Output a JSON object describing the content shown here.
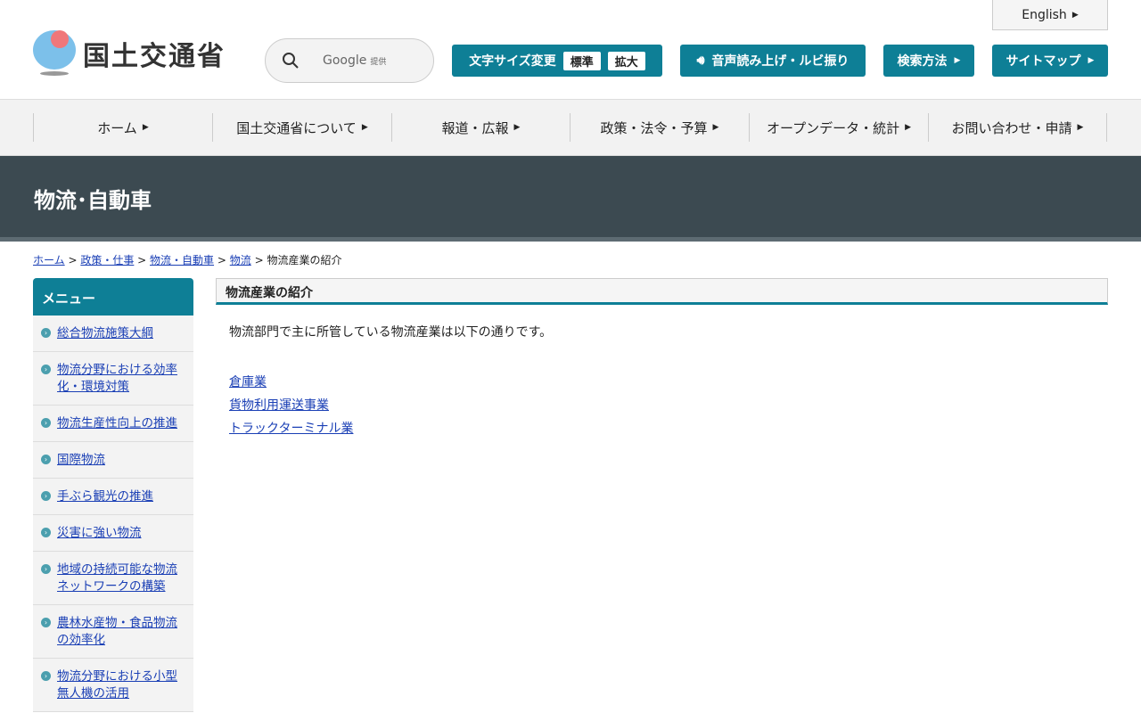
{
  "header": {
    "logo_text": "国土交通省",
    "search_brand": "Google",
    "search_suffix": "提供",
    "font_size_label": "文字サイズ変更",
    "font_standard": "標準",
    "font_large": "拡大",
    "speech_label": "音声読み上げ・ルビ振り",
    "search_method": "検索方法",
    "sitemap": "サイトマップ",
    "english": "English"
  },
  "nav": [
    "ホーム",
    "国土交通省について",
    "報道・広報",
    "政策・法令・予算",
    "オープンデータ・統計",
    "お問い合わせ・申請"
  ],
  "band_title": "物流･自動車",
  "breadcrumb": {
    "links": [
      "ホーム",
      "政策・仕事",
      "物流・自動車",
      "物流"
    ],
    "current": "物流産業の紹介"
  },
  "sidebar": {
    "title": "メニュー",
    "items": [
      "総合物流施策大綱",
      "物流分野における効率化・環境対策",
      "物流生産性向上の推進",
      "国際物流",
      "手ぶら観光の推進",
      "災害に強い物流",
      "地域の持続可能な物流ネットワークの構築",
      "農林水産物・食品物流の効率化",
      "物流分野における小型無人機の活用"
    ]
  },
  "main": {
    "title": "物流産業の紹介",
    "intro": "物流部門で主に所管している物流産業は以下の通りです。",
    "links": [
      "倉庫業",
      "貨物利用運送事業",
      "トラックターミナル業"
    ]
  }
}
